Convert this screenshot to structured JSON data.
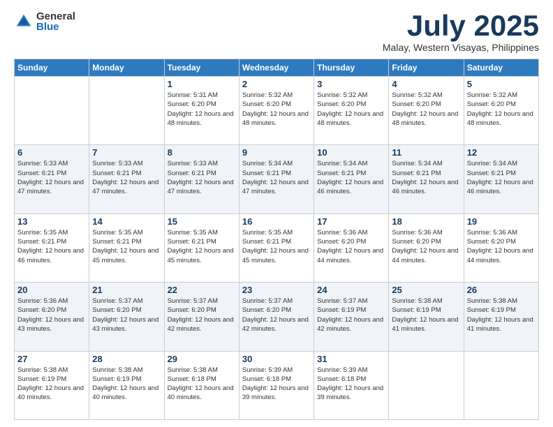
{
  "logo": {
    "general": "General",
    "blue": "Blue"
  },
  "title": {
    "month_year": "July 2025",
    "location": "Malay, Western Visayas, Philippines"
  },
  "weekdays": [
    "Sunday",
    "Monday",
    "Tuesday",
    "Wednesday",
    "Thursday",
    "Friday",
    "Saturday"
  ],
  "weeks": [
    [
      {
        "day": "",
        "sunrise": "",
        "sunset": "",
        "daylight": ""
      },
      {
        "day": "",
        "sunrise": "",
        "sunset": "",
        "daylight": ""
      },
      {
        "day": "1",
        "sunrise": "Sunrise: 5:31 AM",
        "sunset": "Sunset: 6:20 PM",
        "daylight": "Daylight: 12 hours and 48 minutes."
      },
      {
        "day": "2",
        "sunrise": "Sunrise: 5:32 AM",
        "sunset": "Sunset: 6:20 PM",
        "daylight": "Daylight: 12 hours and 48 minutes."
      },
      {
        "day": "3",
        "sunrise": "Sunrise: 5:32 AM",
        "sunset": "Sunset: 6:20 PM",
        "daylight": "Daylight: 12 hours and 48 minutes."
      },
      {
        "day": "4",
        "sunrise": "Sunrise: 5:32 AM",
        "sunset": "Sunset: 6:20 PM",
        "daylight": "Daylight: 12 hours and 48 minutes."
      },
      {
        "day": "5",
        "sunrise": "Sunrise: 5:32 AM",
        "sunset": "Sunset: 6:20 PM",
        "daylight": "Daylight: 12 hours and 48 minutes."
      }
    ],
    [
      {
        "day": "6",
        "sunrise": "Sunrise: 5:33 AM",
        "sunset": "Sunset: 6:21 PM",
        "daylight": "Daylight: 12 hours and 47 minutes."
      },
      {
        "day": "7",
        "sunrise": "Sunrise: 5:33 AM",
        "sunset": "Sunset: 6:21 PM",
        "daylight": "Daylight: 12 hours and 47 minutes."
      },
      {
        "day": "8",
        "sunrise": "Sunrise: 5:33 AM",
        "sunset": "Sunset: 6:21 PM",
        "daylight": "Daylight: 12 hours and 47 minutes."
      },
      {
        "day": "9",
        "sunrise": "Sunrise: 5:34 AM",
        "sunset": "Sunset: 6:21 PM",
        "daylight": "Daylight: 12 hours and 47 minutes."
      },
      {
        "day": "10",
        "sunrise": "Sunrise: 5:34 AM",
        "sunset": "Sunset: 6:21 PM",
        "daylight": "Daylight: 12 hours and 46 minutes."
      },
      {
        "day": "11",
        "sunrise": "Sunrise: 5:34 AM",
        "sunset": "Sunset: 6:21 PM",
        "daylight": "Daylight: 12 hours and 46 minutes."
      },
      {
        "day": "12",
        "sunrise": "Sunrise: 5:34 AM",
        "sunset": "Sunset: 6:21 PM",
        "daylight": "Daylight: 12 hours and 46 minutes."
      }
    ],
    [
      {
        "day": "13",
        "sunrise": "Sunrise: 5:35 AM",
        "sunset": "Sunset: 6:21 PM",
        "daylight": "Daylight: 12 hours and 46 minutes."
      },
      {
        "day": "14",
        "sunrise": "Sunrise: 5:35 AM",
        "sunset": "Sunset: 6:21 PM",
        "daylight": "Daylight: 12 hours and 45 minutes."
      },
      {
        "day": "15",
        "sunrise": "Sunrise: 5:35 AM",
        "sunset": "Sunset: 6:21 PM",
        "daylight": "Daylight: 12 hours and 45 minutes."
      },
      {
        "day": "16",
        "sunrise": "Sunrise: 5:35 AM",
        "sunset": "Sunset: 6:21 PM",
        "daylight": "Daylight: 12 hours and 45 minutes."
      },
      {
        "day": "17",
        "sunrise": "Sunrise: 5:36 AM",
        "sunset": "Sunset: 6:20 PM",
        "daylight": "Daylight: 12 hours and 44 minutes."
      },
      {
        "day": "18",
        "sunrise": "Sunrise: 5:36 AM",
        "sunset": "Sunset: 6:20 PM",
        "daylight": "Daylight: 12 hours and 44 minutes."
      },
      {
        "day": "19",
        "sunrise": "Sunrise: 5:36 AM",
        "sunset": "Sunset: 6:20 PM",
        "daylight": "Daylight: 12 hours and 44 minutes."
      }
    ],
    [
      {
        "day": "20",
        "sunrise": "Sunrise: 5:36 AM",
        "sunset": "Sunset: 6:20 PM",
        "daylight": "Daylight: 12 hours and 43 minutes."
      },
      {
        "day": "21",
        "sunrise": "Sunrise: 5:37 AM",
        "sunset": "Sunset: 6:20 PM",
        "daylight": "Daylight: 12 hours and 43 minutes."
      },
      {
        "day": "22",
        "sunrise": "Sunrise: 5:37 AM",
        "sunset": "Sunset: 6:20 PM",
        "daylight": "Daylight: 12 hours and 42 minutes."
      },
      {
        "day": "23",
        "sunrise": "Sunrise: 5:37 AM",
        "sunset": "Sunset: 6:20 PM",
        "daylight": "Daylight: 12 hours and 42 minutes."
      },
      {
        "day": "24",
        "sunrise": "Sunrise: 5:37 AM",
        "sunset": "Sunset: 6:19 PM",
        "daylight": "Daylight: 12 hours and 42 minutes."
      },
      {
        "day": "25",
        "sunrise": "Sunrise: 5:38 AM",
        "sunset": "Sunset: 6:19 PM",
        "daylight": "Daylight: 12 hours and 41 minutes."
      },
      {
        "day": "26",
        "sunrise": "Sunrise: 5:38 AM",
        "sunset": "Sunset: 6:19 PM",
        "daylight": "Daylight: 12 hours and 41 minutes."
      }
    ],
    [
      {
        "day": "27",
        "sunrise": "Sunrise: 5:38 AM",
        "sunset": "Sunset: 6:19 PM",
        "daylight": "Daylight: 12 hours and 40 minutes."
      },
      {
        "day": "28",
        "sunrise": "Sunrise: 5:38 AM",
        "sunset": "Sunset: 6:19 PM",
        "daylight": "Daylight: 12 hours and 40 minutes."
      },
      {
        "day": "29",
        "sunrise": "Sunrise: 5:38 AM",
        "sunset": "Sunset: 6:18 PM",
        "daylight": "Daylight: 12 hours and 40 minutes."
      },
      {
        "day": "30",
        "sunrise": "Sunrise: 5:39 AM",
        "sunset": "Sunset: 6:18 PM",
        "daylight": "Daylight: 12 hours and 39 minutes."
      },
      {
        "day": "31",
        "sunrise": "Sunrise: 5:39 AM",
        "sunset": "Sunset: 6:18 PM",
        "daylight": "Daylight: 12 hours and 39 minutes."
      },
      {
        "day": "",
        "sunrise": "",
        "sunset": "",
        "daylight": ""
      },
      {
        "day": "",
        "sunrise": "",
        "sunset": "",
        "daylight": ""
      }
    ]
  ]
}
